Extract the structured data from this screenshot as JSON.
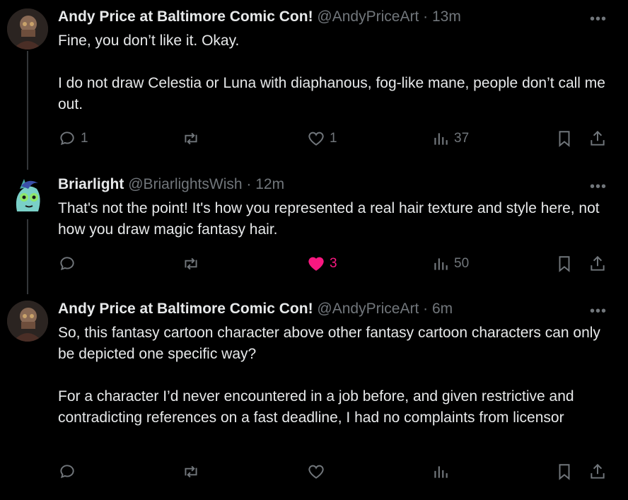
{
  "tweets": [
    {
      "name": "Andy Price at Baltimore Comic Con!",
      "handle": "@AndyPriceArt",
      "dot": "·",
      "time": "13m",
      "lines": [
        "Fine, you don’t like it. Okay.",
        "",
        "I do not draw Celestia or Luna with diaphanous, fog-like mane, people don’t call me out."
      ],
      "replies": "1",
      "retweets": "",
      "likes": "1",
      "views": "37",
      "liked": false
    },
    {
      "name": "Briarlight",
      "handle": "@BriarlightsWish",
      "dot": "·",
      "time": "12m",
      "lines": [
        "That's not the point! It's how you represented a real hair texture and style here, not how you draw magic fantasy hair."
      ],
      "replies": "",
      "retweets": "",
      "likes": "3",
      "views": "50",
      "liked": true
    },
    {
      "name": "Andy Price at Baltimore Comic Con!",
      "handle": "@AndyPriceArt",
      "dot": "·",
      "time": "6m",
      "lines": [
        "So, this fantasy cartoon character above other fantasy cartoon characters can only be depicted one specific way?",
        "",
        "For a character I’d never encountered in a job before, and given restrictive and contradicting references on a fast deadline, I had no complaints from licensor"
      ],
      "replies": "",
      "retweets": "",
      "likes": "",
      "views": "",
      "liked": false
    }
  ],
  "icons": {
    "reply": "reply-icon",
    "retweet": "retweet-icon",
    "like": "heart-icon",
    "views": "views-icon",
    "bookmark": "bookmark-icon",
    "share": "share-icon",
    "more": "more-icon"
  },
  "colors": {
    "background": "#000000",
    "text": "#e7e9ea",
    "muted": "#71767b",
    "like": "#f91880"
  }
}
